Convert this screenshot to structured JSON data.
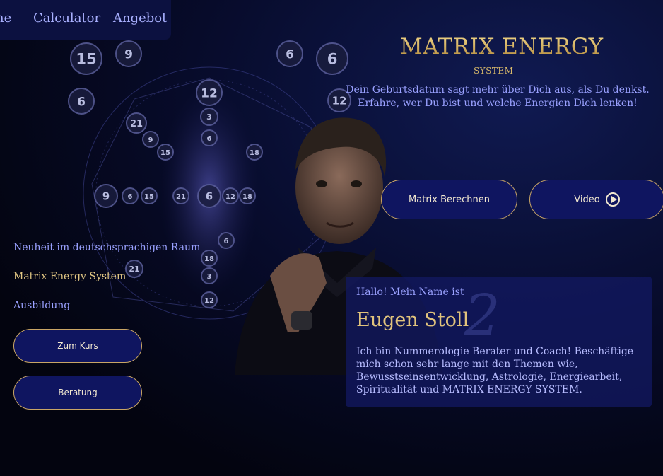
{
  "nav": {
    "items": [
      "ne",
      "Calculator",
      "Angebot"
    ]
  },
  "hero": {
    "title": "MATRIX ENERGY",
    "subtitle": "SYSTEM",
    "tagline": "Dein Geburtsdatum sagt mehr über Dich aus, als Du denkst. Erfahre, wer Du bist und welche Energien Dich lenken!",
    "btn_matrix": "Matrix Berechnen",
    "btn_video": "Video"
  },
  "side": {
    "line1": "Neuheit im deutschsprachigen Raum",
    "line2": "Matrix Energy System",
    "line3": "Ausbildung",
    "btn_course": "Zum Kurs",
    "btn_consult": "Beratung"
  },
  "card": {
    "hello": "Hallo! Mein Name ist",
    "name": "Eugen Stoll",
    "deco_number": "2",
    "bio": "Ich bin Nummerologie Berater und Coach! Beschäftige mich schon sehr lange mit den Themen wie, Bewusstseinsentwicklung, Astrologie, Energiearbeit, Spiritualität und MATRIX ENERGY SYSTEM."
  },
  "matrix": {
    "badges": [
      "15",
      "9",
      "6",
      "12",
      "6",
      "6",
      "12",
      "3",
      "21",
      "9",
      "6",
      "18",
      "15",
      "9",
      "6",
      "15",
      "21",
      "6",
      "12",
      "18",
      "6",
      "21",
      "18",
      "3",
      "12"
    ]
  },
  "colors": {
    "accent": "#c9a566",
    "bg": "#070b2a",
    "button": "#0f1560",
    "link": "#9aa1ff"
  }
}
